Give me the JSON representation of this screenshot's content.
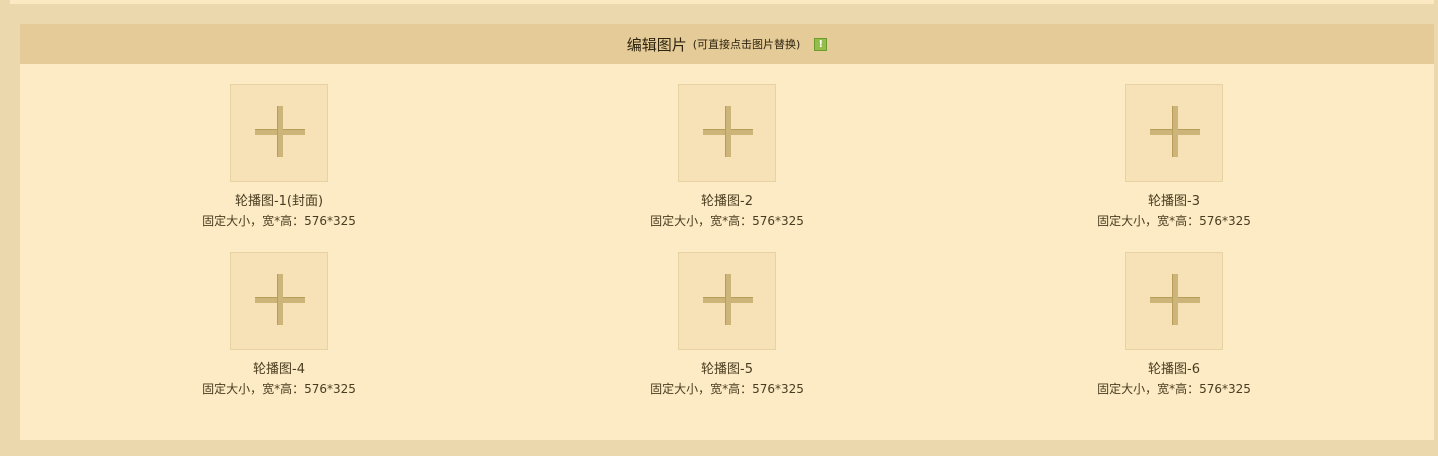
{
  "header": {
    "title": "编辑图片",
    "subtitle": "(可直接点击图片替换)",
    "hint_icon": "info-icon",
    "hint_color": "#95bd4a"
  },
  "slots": [
    {
      "name": "轮播图-1(封面)",
      "size": "固定大小，宽*高：576*325"
    },
    {
      "name": "轮播图-2",
      "size": "固定大小，宽*高：576*325"
    },
    {
      "name": "轮播图-3",
      "size": "固定大小，宽*高：576*325"
    },
    {
      "name": "轮播图-4",
      "size": "固定大小，宽*高：576*325"
    },
    {
      "name": "轮播图-5",
      "size": "固定大小，宽*高：576*325"
    },
    {
      "name": "轮播图-6",
      "size": "固定大小，宽*高：576*325"
    }
  ],
  "colors": {
    "page_bg": "#ecd8ad",
    "panel_bg": "#fcebc4",
    "header_bg": "#e4cb97",
    "slot_bg": "#f7e2b8"
  }
}
